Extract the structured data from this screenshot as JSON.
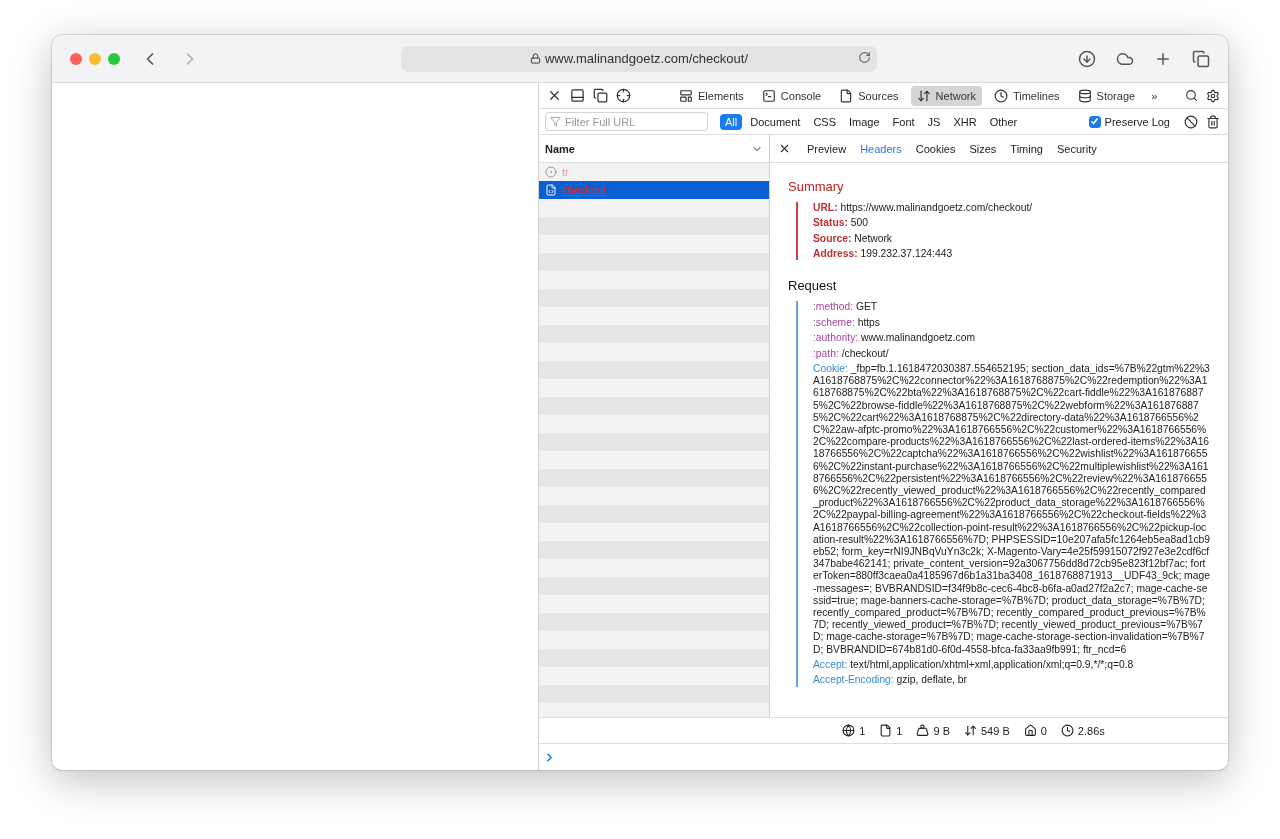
{
  "browser": {
    "url": "www.malinandgoetz.com/checkout/"
  },
  "devtools": {
    "tabs": [
      {
        "label": "Elements",
        "kind": "elements",
        "selected": false
      },
      {
        "label": "Console",
        "kind": "console",
        "selected": false
      },
      {
        "label": "Sources",
        "kind": "sources",
        "selected": false
      },
      {
        "label": "Network",
        "kind": "network",
        "selected": true
      },
      {
        "label": "Timelines",
        "kind": "timelines",
        "selected": false
      },
      {
        "label": "Storage",
        "kind": "storage",
        "selected": false
      }
    ],
    "more": "»",
    "filter": {
      "placeholder": "Filter Full URL"
    },
    "types": [
      {
        "label": "All",
        "selected": true
      },
      {
        "label": "Document",
        "selected": false
      },
      {
        "label": "CSS",
        "selected": false
      },
      {
        "label": "Image",
        "selected": false
      },
      {
        "label": "Font",
        "selected": false
      },
      {
        "label": "JS",
        "selected": false
      },
      {
        "label": "XHR",
        "selected": false
      },
      {
        "label": "Other",
        "selected": false
      }
    ],
    "preserve_log": {
      "label": "Preserve Log",
      "checked": true
    },
    "list_header": "Name",
    "requests": [
      {
        "name": "tr",
        "kind": "beacon",
        "selected": false
      },
      {
        "name": "checkout",
        "kind": "document",
        "selected": true
      }
    ],
    "detail_tabs": [
      {
        "label": "Preview",
        "selected": false
      },
      {
        "label": "Headers",
        "selected": true
      },
      {
        "label": "Cookies",
        "selected": false
      },
      {
        "label": "Sizes",
        "selected": false
      },
      {
        "label": "Timing",
        "selected": false
      },
      {
        "label": "Security",
        "selected": false
      }
    ],
    "sections": [
      {
        "title": "Summary",
        "kind": "summary",
        "rows": [
          {
            "key": "URL:",
            "value": "https://www.malinandgoetz.com/checkout/"
          },
          {
            "key": "Status:",
            "value": "500"
          },
          {
            "key": "Source:",
            "value": "Network"
          },
          {
            "key": "Address:",
            "value": "199.232.37.124:443"
          }
        ]
      },
      {
        "title": "Request",
        "kind": "request",
        "rows": [
          {
            "key": ":method:",
            "value": "GET",
            "kind": "pseudo"
          },
          {
            "key": ":scheme:",
            "value": "https",
            "kind": "pseudo"
          },
          {
            "key": ":authority:",
            "value": "www.malinandgoetz.com",
            "kind": "pseudo"
          },
          {
            "key": ":path:",
            "value": "/checkout/",
            "kind": "pseudo"
          },
          {
            "key": "Cookie:",
            "kind": "header",
            "value": "_fbp=fb.1.1618472030387.554652195; section_data_ids=%7B%22gtm%22%3A1618768875%2C%22connector%22%3A1618768875%2C%22redemption%22%3A1618768875%2C%22bta%22%3A1618768875%2C%22cart-fiddle%22%3A1618768875%2C%22browse-fiddle%22%3A1618768875%2C%22webform%22%3A1618768875%2C%22cart%22%3A1618768875%2C%22directory-data%22%3A1618766556%2C%22aw-afptc-promo%22%3A1618766556%2C%22customer%22%3A1618766556%2C%22compare-products%22%3A1618766556%2C%22last-ordered-items%22%3A1618766556%2C%22captcha%22%3A1618766556%2C%22wishlist%22%3A1618766556%2C%22instant-purchase%22%3A1618766556%2C%22multiplewishlist%22%3A1618766556%2C%22persistent%22%3A1618766556%2C%22review%22%3A1618766556%2C%22recently_viewed_product%22%3A1618766556%2C%22recently_compared_product%22%3A1618766556%2C%22product_data_storage%22%3A1618766556%2C%22paypal-billing-agreement%22%3A1618766556%2C%22checkout-fields%22%3A1618766556%2C%22collection-point-result%22%3A1618766556%2C%22pickup-location-result%22%3A1618766556%7D; PHPSESSID=10e207afa5fc1264eb5ea8ad1cb9eb52; form_key=rNI9JNBqVuYn3c2k; X-Magento-Vary=4e25f59915072f927e3e2cdf6cf347babe462141; private_content_version=92a3067756dd8d72cb95e823f12bf7ac; forterToken=880ff3caea0a4185967d6b1a31ba3408_1618768871913__UDF43_9ck; mage-messages=; BVBRANDSID=f34f9b8c-cec6-4bc8-b6fa-a0ad27f2a2c7; mage-cache-sessid=true; mage-banners-cache-storage=%7B%7D; product_data_storage=%7B%7D; recently_compared_product=%7B%7D; recently_compared_product_previous=%7B%7D; recently_viewed_product=%7B%7D; recently_viewed_product_previous=%7B%7D; mage-cache-storage=%7B%7D; mage-cache-storage-section-invalidation=%7B%7D; BVBRANDID=674b81d0-6f0d-4558-bfca-fa33aa9fb991; ftr_ncd=6"
          },
          {
            "key": "Accept:",
            "value": "text/html,application/xhtml+xml,application/xml;q=0.9,*/*;q=0.8",
            "kind": "header"
          },
          {
            "key": "Accept-Encoding:",
            "value": "gzip, deflate, br",
            "kind": "header"
          }
        ]
      }
    ],
    "status": [
      {
        "kind": "domains",
        "text": "1"
      },
      {
        "kind": "resources",
        "text": "1"
      },
      {
        "kind": "transferred",
        "text": "9 B"
      },
      {
        "kind": "size",
        "text": "549 B"
      },
      {
        "kind": "redirects",
        "text": "0"
      },
      {
        "kind": "time",
        "text": "2.86s"
      }
    ]
  }
}
